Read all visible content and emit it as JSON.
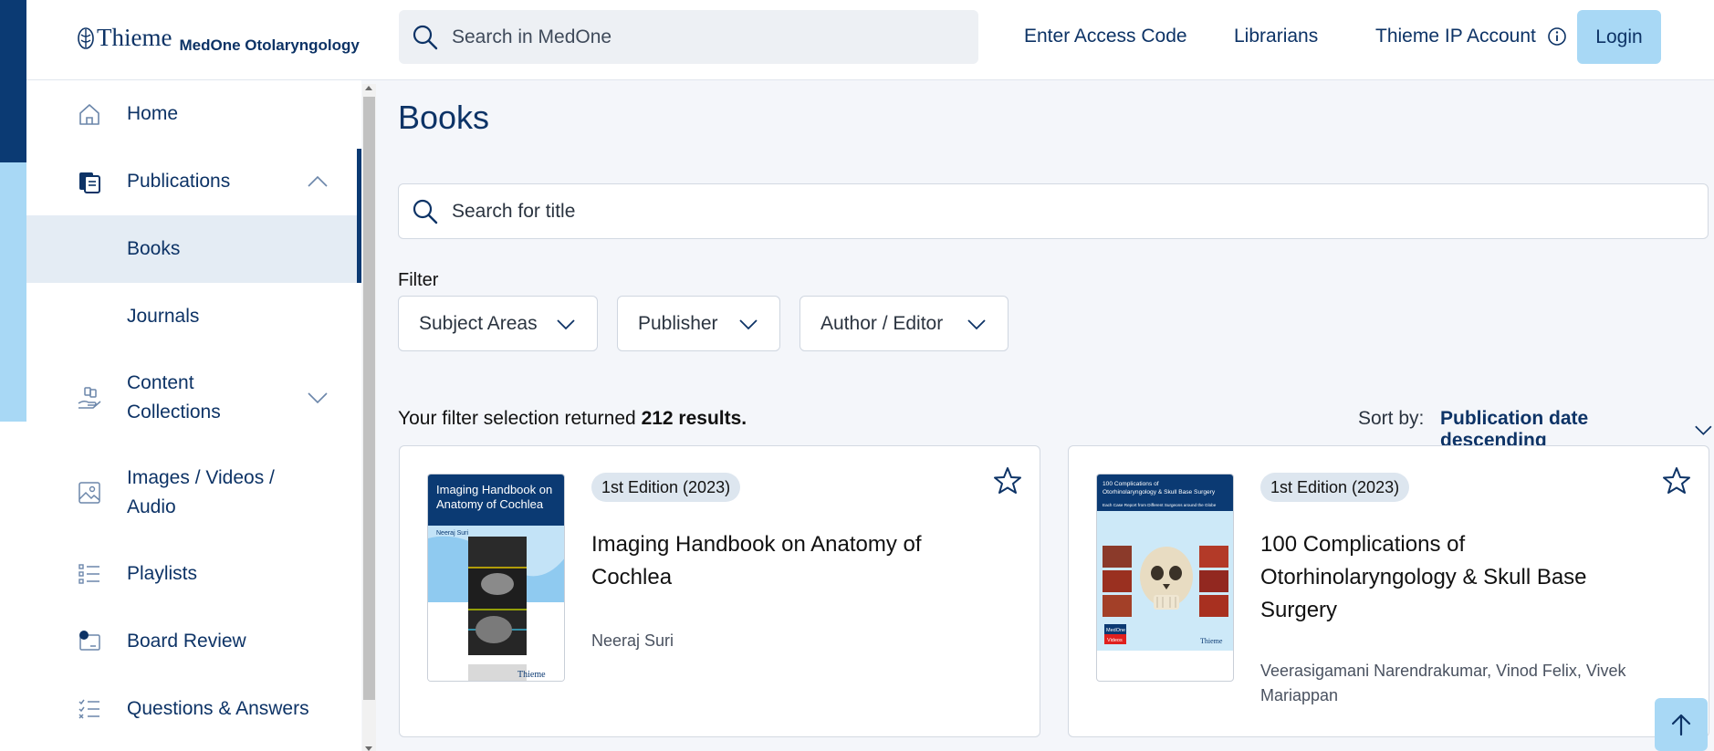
{
  "header": {
    "brand": "Thieme",
    "product": "MedOne Otolaryngology",
    "search_placeholder": "Search in MedOne",
    "links": [
      "Enter Access Code",
      "Librarians",
      "Thieme IP Account"
    ],
    "login_label": "Login"
  },
  "sidebar": {
    "items": [
      {
        "label": "Home",
        "icon": "home-icon"
      },
      {
        "label": "Publications",
        "icon": "publications-icon",
        "expanded": true
      },
      {
        "label": "Books",
        "active": true
      },
      {
        "label": "Journals"
      },
      {
        "label": "Content Collections",
        "icon": "collections-icon",
        "expanded": false
      },
      {
        "label": "Images / Videos / Audio",
        "icon": "image-icon"
      },
      {
        "label": "Playlists",
        "icon": "playlist-icon"
      },
      {
        "label": "Board Review",
        "icon": "board-review-icon"
      },
      {
        "label": "Questions & Answers",
        "icon": "qa-icon"
      }
    ]
  },
  "main": {
    "title": "Books",
    "search_placeholder": "Search for title",
    "filter_label": "Filter",
    "filters": [
      "Subject Areas",
      "Publisher",
      "Author / Editor"
    ],
    "results_prefix": "Your filter selection returned",
    "results_count": "212 results.",
    "sort_label": "Sort by:",
    "sort_value": "Publication date descending"
  },
  "books": [
    {
      "edition": "1st Edition (2023)",
      "title": "Imaging Handbook on Anatomy of Cochlea",
      "authors": "Neeraj Suri",
      "cover_title": "Imaging Handbook on Anatomy of Cochlea",
      "cover_author": "Neeraj Suri",
      "cover_publisher": "Thieme"
    },
    {
      "edition": "1st Edition (2023)",
      "title": "100 Complications of Otorhinolaryngology & Skull Base Surgery",
      "authors": "Veerasigamani Narendrakumar, Vinod Felix, Vivek Mariappan",
      "cover_title": "100 Complications of Otorhinolaryngology & Skull Base Surgery",
      "cover_subtitle": "Each Case Report from Different Surgeons around the Globe",
      "cover_badge_line1": "MedOne",
      "cover_badge_line2": "Videos",
      "cover_publisher": "Thieme"
    }
  ],
  "colors": {
    "brand_navy": "#0b3a73",
    "accent_light_blue": "#a8d8f5",
    "active_nav_bg": "#e4ecf4"
  }
}
